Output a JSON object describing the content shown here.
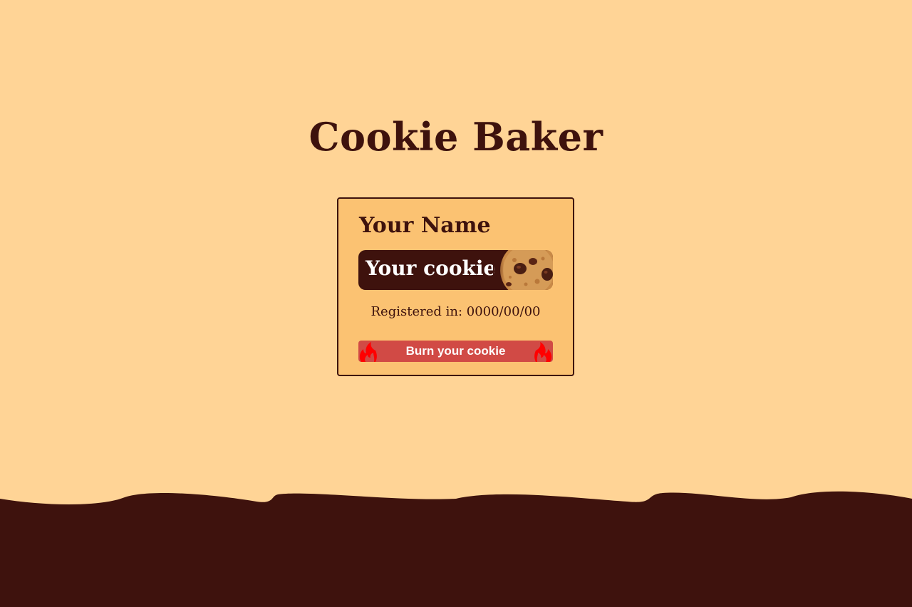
{
  "app": {
    "title": "Cookie Baker"
  },
  "card": {
    "name": "Your Name",
    "cookie_label": "Your cookie",
    "registered": "Registered in: 0000/00/00",
    "burn_button": "Burn your cookie"
  },
  "colors": {
    "background": "#FFD496",
    "card": "#FBC272",
    "chocolate": "#3E120D",
    "burn": "#D14A45",
    "flame": "#FF0000"
  },
  "icons": {
    "cookie": "cookie-image",
    "flame": "flame-icon"
  }
}
